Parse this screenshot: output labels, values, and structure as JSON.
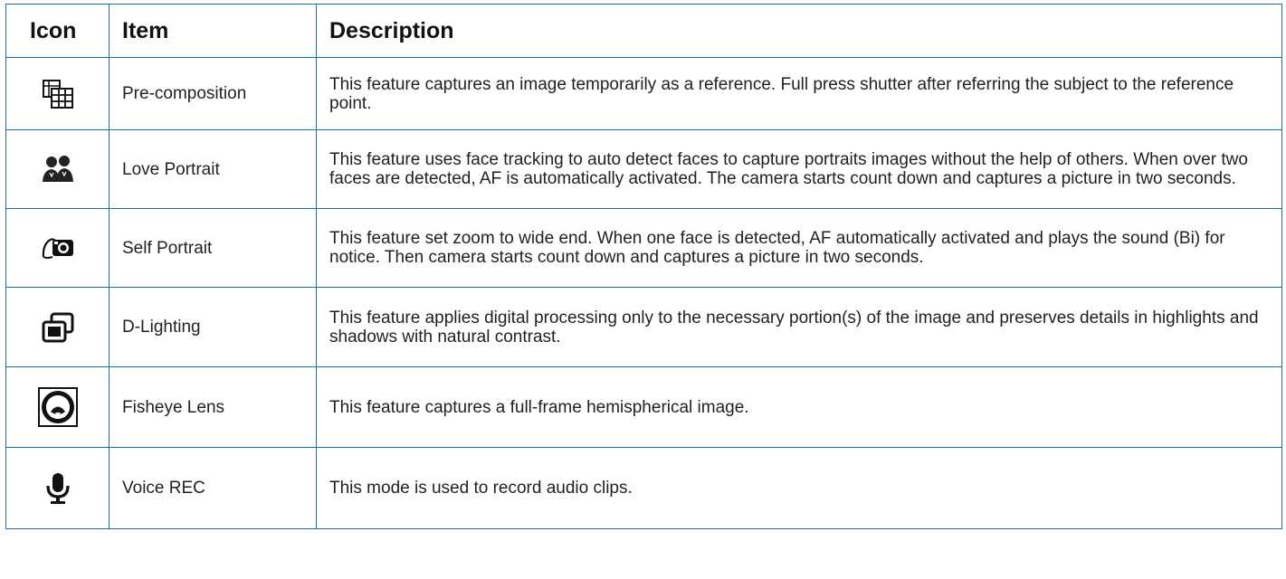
{
  "table": {
    "headers": {
      "icon": "Icon",
      "item": "Item",
      "description": "Description"
    },
    "rows": [
      {
        "icon": "pre-composition-icon",
        "item": "Pre-composition",
        "description": "This feature captures an image temporarily as a reference. Full press shutter after referring the subject to the reference point."
      },
      {
        "icon": "love-portrait-icon",
        "item": "Love Portrait",
        "description": "This feature uses face tracking to auto detect faces to capture portraits images without the help of others. When over two faces are detected, AF is automatically activated. The camera starts count down and captures a picture in two seconds."
      },
      {
        "icon": "self-portrait-icon",
        "item": "Self Portrait",
        "description": "This feature set zoom to wide end. When one face is detected, AF automatically activated and plays the sound (Bi) for notice. Then camera starts count down and captures a picture in two seconds."
      },
      {
        "icon": "d-lighting-icon",
        "item": "D-Lighting",
        "description": "This feature applies digital processing only to the necessary portion(s) of the image and preserves details in highlights and shadows with natural contrast."
      },
      {
        "icon": "fisheye-lens-icon",
        "item": "Fisheye Lens",
        "description": "This feature captures a full-frame hemispherical image."
      },
      {
        "icon": "microphone-icon",
        "item": "Voice REC",
        "description": "This mode is used to record audio clips."
      }
    ]
  },
  "colors": {
    "border": "#1b6fa8",
    "text": "#231f20"
  }
}
